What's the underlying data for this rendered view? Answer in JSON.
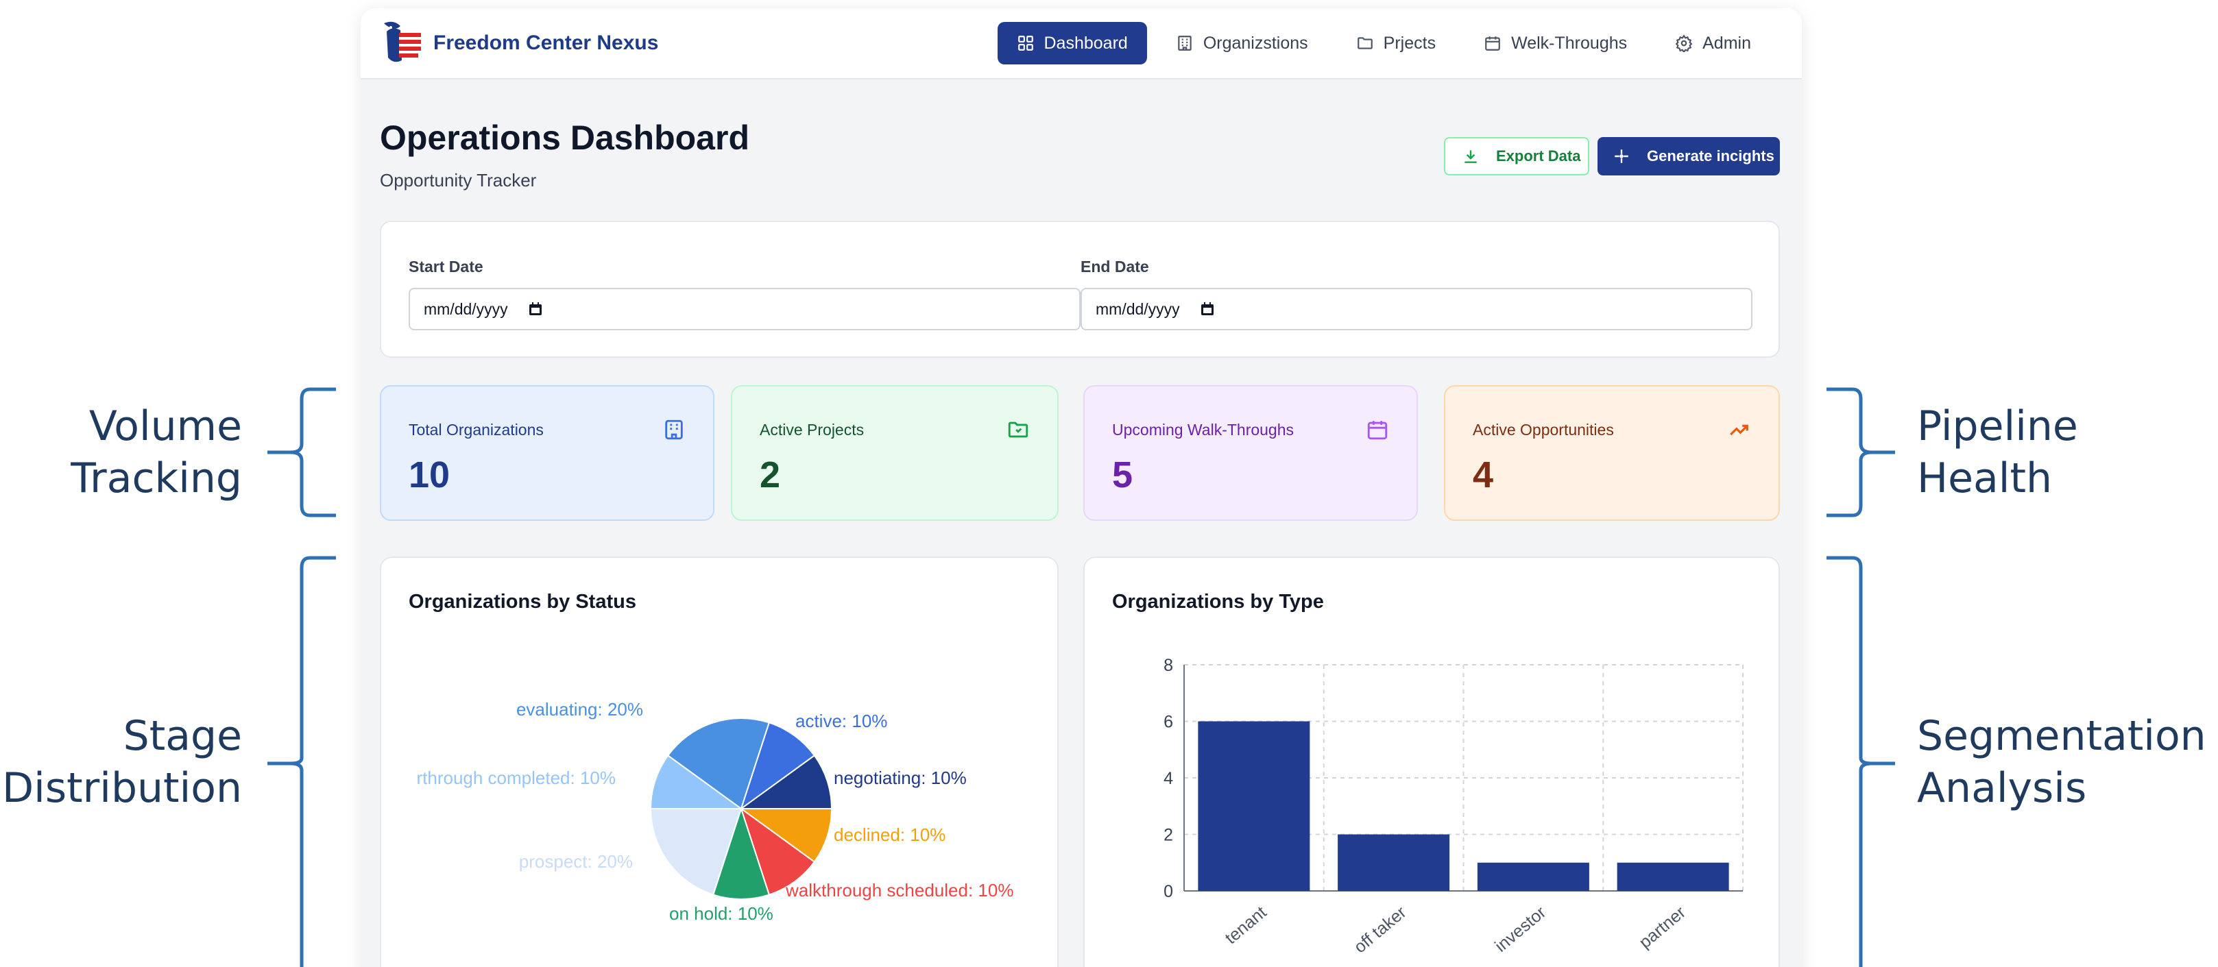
{
  "annotations": {
    "volume": [
      "Volume",
      "Tracking"
    ],
    "stage": [
      "Stage",
      "Distribution"
    ],
    "pipeline": [
      "Pipeline",
      "Health"
    ],
    "segmentation": [
      "Segmentation",
      "Analysis"
    ]
  },
  "brand": {
    "name": "Freedom Center Nexus"
  },
  "nav": [
    {
      "label": "Dashboard",
      "icon": "dashboard-icon",
      "active": true
    },
    {
      "label": "Organizstions",
      "icon": "building-icon",
      "active": false
    },
    {
      "label": "Prjects",
      "icon": "folder-icon",
      "active": false
    },
    {
      "label": "Welk-Throughs",
      "icon": "calendar-icon",
      "active": false
    },
    {
      "label": "Admin",
      "icon": "gear-icon",
      "active": false
    }
  ],
  "header": {
    "title": "Operations Dashboard",
    "subtitle": "Opportunity Tracker",
    "export_label": "Export Data",
    "generate_label": "Generate incights"
  },
  "filters": {
    "start_label": "Start Date",
    "start_placeholder": "mm/dd/yyyy",
    "end_label": "End Date",
    "end_placeholder": "mm/dd/yyyy"
  },
  "stats": [
    {
      "label": "Total Organizations",
      "value": "10",
      "icon": "building-icon",
      "color": "#1e3a8a",
      "bg": "#e8f0fe",
      "border": "#bfdbfe"
    },
    {
      "label": "Active Projects",
      "value": "2",
      "icon": "folder-icon",
      "color": "#14532d",
      "bg": "#e9fbee",
      "border": "#bbf7d0"
    },
    {
      "label": "Upcoming Walk-Throughs",
      "value": "5",
      "icon": "calendar-icon",
      "color": "#6b21a8",
      "bg": "#f5ecfd",
      "border": "#e9d5ff"
    },
    {
      "label": "Active Opportunities",
      "value": "4",
      "icon": "trending-up-icon",
      "color": "#7c2d12",
      "bg": "#fff1e3",
      "border": "#fed7aa"
    }
  ],
  "chart_data": [
    {
      "type": "pie",
      "title": "Organizations by Status",
      "slices": [
        {
          "label": "evaluating: 20%",
          "value": 20,
          "color": "#4a90e2"
        },
        {
          "label": "active: 10%",
          "value": 10,
          "color": "#3b6fe0"
        },
        {
          "label": "negotiating: 10%",
          "value": 10,
          "color": "#1e3a8a"
        },
        {
          "label": "declined: 10%",
          "value": 10,
          "color": "#f59e0b"
        },
        {
          "label": "walkthrough scheduled: 10%",
          "value": 10,
          "color": "#ef4444"
        },
        {
          "label": "on hold: 10%",
          "value": 10,
          "color": "#22a06b"
        },
        {
          "label": "prospect: 20%",
          "value": 20,
          "color": "#dbe8fa"
        },
        {
          "label": "rthrough completed: 10%",
          "value": 10,
          "color": "#93c5fd"
        }
      ]
    },
    {
      "type": "bar",
      "title": "Organizations by Type",
      "categories": [
        "tenant",
        "off taker",
        "investor",
        "partner"
      ],
      "values": [
        6,
        2,
        1,
        1
      ],
      "ylim": [
        0,
        8
      ],
      "yticks": [
        0,
        2,
        4,
        6,
        8
      ],
      "grid": true,
      "color": "#213b8f"
    }
  ]
}
